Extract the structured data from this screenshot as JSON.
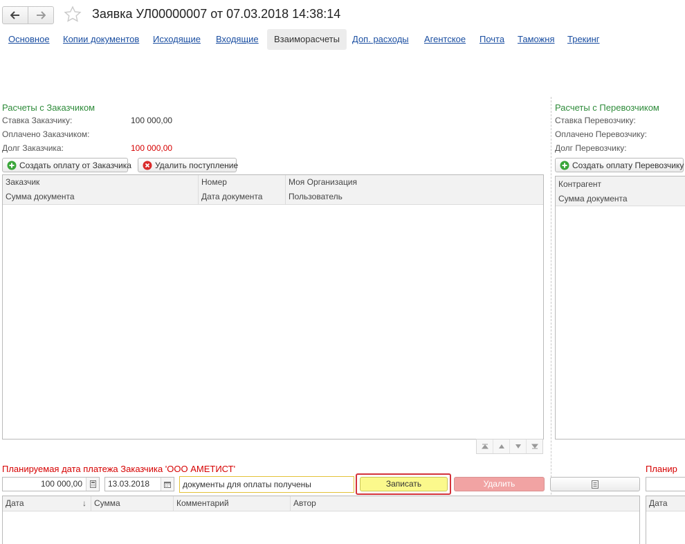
{
  "header": {
    "title": "Заявка УЛ00000007 от 07.03.2018 14:38:14",
    "back_icon": "arrow-left-icon",
    "forward_icon": "arrow-right-icon",
    "favorite_icon": "star-icon"
  },
  "tabs": [
    {
      "label": "Основное",
      "active": false
    },
    {
      "label": "Копии документов",
      "active": false
    },
    {
      "label": "Исходящие",
      "active": false
    },
    {
      "label": "Входящие",
      "active": false
    },
    {
      "label": "Взаиморасчеты",
      "active": true
    },
    {
      "label": "Доп. расходы",
      "active": false
    },
    {
      "label": "Агентское",
      "active": false
    },
    {
      "label": "Почта",
      "active": false
    },
    {
      "label": "Таможня",
      "active": false
    },
    {
      "label": "Трекинг",
      "active": false
    }
  ],
  "customer": {
    "title": "Расчеты с Заказчиком",
    "rate_label": "Ставка Заказчику:",
    "rate_value": "100 000,00",
    "paid_label": "Оплачено Заказчиком:",
    "paid_value": "",
    "debt_label": "Долг Заказчика:",
    "debt_value": "100 000,00",
    "create_payment_button": "Создать оплату от Заказчика",
    "delete_receipt_button": "Удалить поступление",
    "table": {
      "row1": [
        "Заказчик",
        "Номер",
        "Моя Организация"
      ],
      "row2": [
        "Сумма документа",
        "Дата документа",
        "Пользователь"
      ]
    }
  },
  "carrier": {
    "title": "Расчеты с Перевозчиком",
    "rate_label": "Ставка Перевозчику:",
    "paid_label": "Оплачено Перевозчику:",
    "debt_label": "Долг Перевозчику:",
    "create_payment_button": "Создать оплату Перевозчику",
    "table": {
      "row1": [
        "Контрагент"
      ],
      "row2": [
        "Сумма документа"
      ]
    }
  },
  "plan_customer": {
    "title": "Планируемая дата платежа Заказчика 'ООО АМЕТИСТ'",
    "amount": "100 000,00",
    "date": "13.03.2018",
    "comment": "документы для оплаты получены",
    "save_button": "Записать",
    "delete_button": "Удалить",
    "table_headers": [
      "Дата",
      "Сумма",
      "Комментарий",
      "Автор"
    ]
  },
  "plan_carrier": {
    "title_partial": "Планир",
    "table_header": "Дата"
  },
  "colors": {
    "section_title": "#2e8b3a",
    "warning_red": "#d60000",
    "save_yellow": "#fbf98c",
    "delete_pink": "#f1a3a3",
    "link_blue": "#1a4ea1"
  }
}
